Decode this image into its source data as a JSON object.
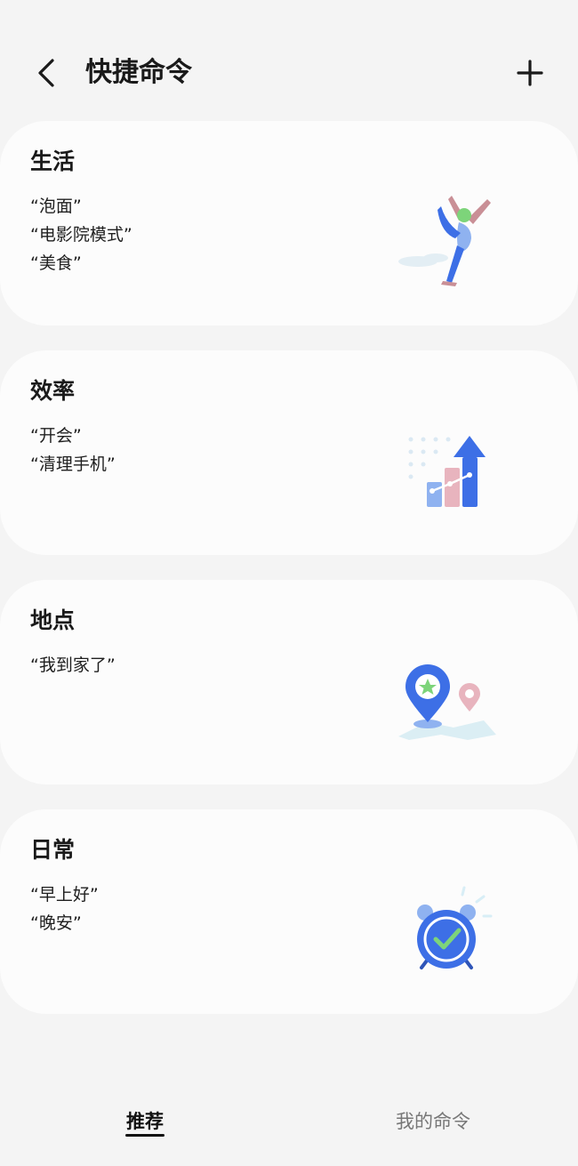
{
  "header": {
    "title": "快捷命令"
  },
  "cards": [
    {
      "title": "生活",
      "examples": [
        "“泡面”",
        "“电影院模式”",
        "“美食”"
      ],
      "icon": "yoga-pose-icon"
    },
    {
      "title": "效率",
      "examples": [
        "“开会”",
        "“清理手机”"
      ],
      "icon": "growth-chart-icon"
    },
    {
      "title": "地点",
      "examples": [
        "“我到家了”"
      ],
      "icon": "location-pin-icon"
    },
    {
      "title": "日常",
      "examples": [
        "“早上好”",
        "“晚安”"
      ],
      "icon": "alarm-clock-icon"
    }
  ],
  "tabs": [
    {
      "label": "推荐",
      "selected": true
    },
    {
      "label": "我的命令",
      "selected": false
    }
  ],
  "colors": {
    "background": "#f4f4f4",
    "card": "#fcfcfc",
    "accent_blue": "#3d6fe6",
    "accent_pink": "#e8b4be",
    "accent_green": "#7dd47a"
  }
}
